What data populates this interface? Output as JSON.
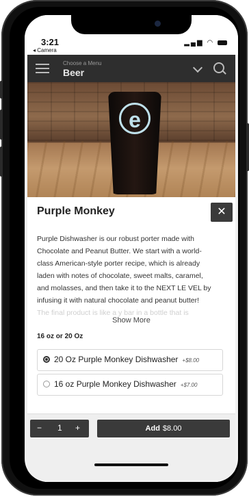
{
  "status": {
    "time": "3:21",
    "back": "◂ Camera"
  },
  "menu": {
    "label": "Choose a Menu",
    "value": "Beer"
  },
  "item": {
    "name": "Purple Monkey",
    "close": "✕",
    "description_lines": [
      "Purple Dishwasher is our robust porter made with",
      "Chocolate and Peanut Butter. We start with a world-",
      "class American-style porter recipe, which is already",
      "laden with notes of chocolate, sweet malts, caramel,",
      "and molasses, and then take it to the NEXT LE VEL by",
      "infusing it with natural chocolate and peanut butter!"
    ],
    "description_fade": "The final product is like a y bar in a bottle that is",
    "show_more": "Show More",
    "logo": "e"
  },
  "options": {
    "heading": "16 oz or 20 Oz",
    "items": [
      {
        "name": "20 Oz Purple Monkey Dishwasher",
        "price": "+$8.00",
        "selected": true
      },
      {
        "name": "16 oz Purple Monkey Dishwasher",
        "price": "+$7.00",
        "selected": false
      }
    ]
  },
  "footer": {
    "minus": "−",
    "quantity": "1",
    "plus": "+",
    "add_label": "Add",
    "add_price": "$8.00"
  }
}
